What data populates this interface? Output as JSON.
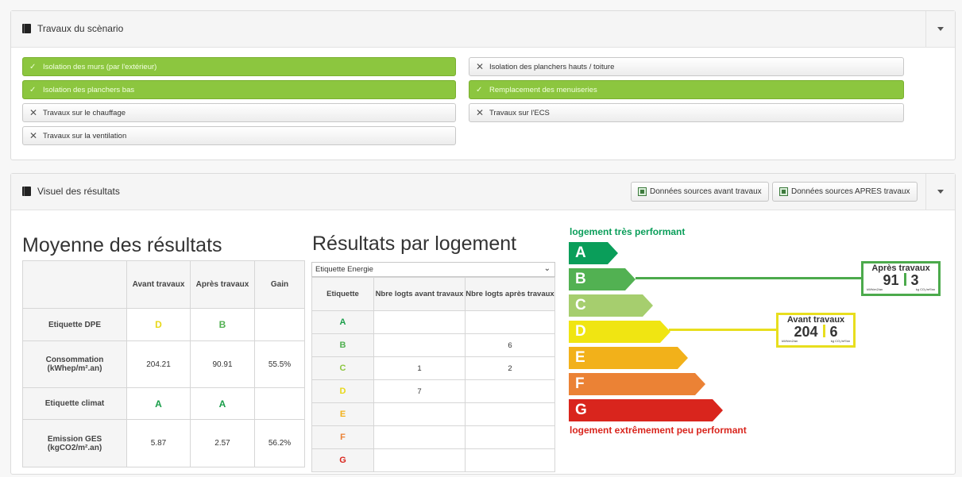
{
  "scenario_panel": {
    "title": "Travaux du scènario",
    "items": [
      {
        "label": "Isolation des murs  (par l'extérieur)",
        "active": true
      },
      {
        "label": "Isolation des planchers hauts / toiture",
        "active": false
      },
      {
        "label": "Isolation des planchers bas",
        "active": true
      },
      {
        "label": "Remplacement des menuiseries",
        "active": true
      },
      {
        "label": "Travaux sur le chauffage",
        "active": false
      },
      {
        "label": "Travaux sur l'ECS",
        "active": false
      },
      {
        "label": "Travaux sur la ventilation",
        "active": false
      }
    ],
    "check_mark": "✓",
    "cross_mark": "✕"
  },
  "results_panel": {
    "title": "Visuel des résultats",
    "btn_before": "Données sources avant travaux",
    "btn_after": "Données sources APRES travaux"
  },
  "average": {
    "heading": "Moyenne des résultats",
    "columns": [
      "",
      "Avant travaux",
      "Après travaux",
      "Gain"
    ],
    "rows": [
      {
        "label": "Etiquette DPE",
        "avant": "D",
        "apres": "B",
        "gain": ""
      },
      {
        "label": "Consommation (kWhep/m².an)",
        "avant": "204.21",
        "apres": "90.91",
        "gain": "55.5%"
      },
      {
        "label": "Etiquette climat",
        "avant": "A",
        "apres": "A",
        "gain": ""
      },
      {
        "label": "Emission GES (kgCO2/m².an)",
        "avant": "5.87",
        "apres": "2.57",
        "gain": "56.2%"
      }
    ]
  },
  "per_unit": {
    "heading": "Résultats par logement",
    "select_value": "Etiquette Energie",
    "columns": [
      "Etiquette",
      "Nbre logts avant travaux",
      "Nbre logts après travaux"
    ],
    "rows": [
      {
        "label": "A",
        "avant": "",
        "apres": ""
      },
      {
        "label": "B",
        "avant": "",
        "apres": "6"
      },
      {
        "label": "C",
        "avant": "1",
        "apres": "2"
      },
      {
        "label": "D",
        "avant": "7",
        "apres": ""
      },
      {
        "label": "E",
        "avant": "",
        "apres": ""
      },
      {
        "label": "F",
        "avant": "",
        "apres": ""
      },
      {
        "label": "G",
        "avant": "",
        "apres": ""
      }
    ]
  },
  "scale": {
    "top_label": "logement très performant",
    "bottom_label": "logement extrêmement peu performant",
    "classes": [
      "A",
      "B",
      "C",
      "D",
      "E",
      "F",
      "G"
    ],
    "colors": [
      "#0a9e5a",
      "#52b152",
      "#a6ce6e",
      "#f0e512",
      "#f2b11a",
      "#eb8235",
      "#d9251d"
    ],
    "after": {
      "title": "Après travaux",
      "energy": "91",
      "ges": "3",
      "energy_unit": "kWh/m2/an",
      "ges_unit": "kg CO₂/m²/an",
      "color": "#4caa4c"
    },
    "before": {
      "title": "Avant travaux",
      "energy": "204",
      "ges": "6",
      "energy_unit": "kWh/m2/an",
      "ges_unit": "kg CO₂/m²/an",
      "color": "#e8de1e"
    }
  },
  "label_colors": {
    "A": "#1a9e4a",
    "B": "#52b152",
    "C": "#8cc63f",
    "D": "#e8d81a",
    "E": "#f2b11a",
    "F": "#eb8235",
    "G": "#d9251d"
  }
}
